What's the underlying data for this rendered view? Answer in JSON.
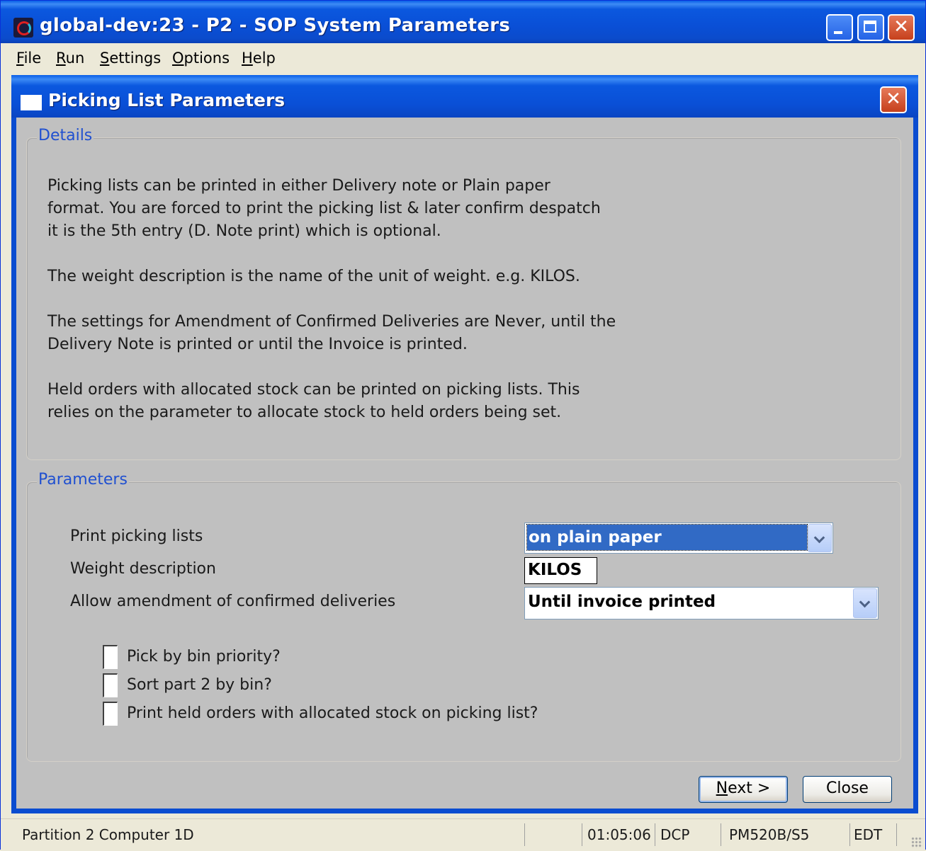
{
  "window": {
    "title": "global-dev:23 - P2 - SOP System Parameters"
  },
  "menu": {
    "items": [
      {
        "accel": "F",
        "rest": "ile"
      },
      {
        "accel": "R",
        "rest": "un"
      },
      {
        "accel": "S",
        "rest": "ettings"
      },
      {
        "accel": "O",
        "rest": "ptions"
      },
      {
        "accel": "H",
        "rest": "elp"
      }
    ]
  },
  "dialog": {
    "title": "Picking List Parameters",
    "details": {
      "legend": "Details",
      "para1": [
        "Picking lists can be printed in either Delivery note or Plain paper",
        "format. You are forced to print the picking list & later confirm despatch",
        "it is the 5th entry (D. Note print) which is optional."
      ],
      "para2": [
        "The weight description is the name of the unit of weight. e.g. KILOS."
      ],
      "para3": [
        "The settings for Amendment of Confirmed Deliveries are Never, until the",
        "Delivery Note is printed or until the Invoice is printed."
      ],
      "para4": [
        "Held orders with allocated stock can be printed on picking lists. This",
        "relies on the parameter to allocate stock to held orders being set."
      ]
    },
    "parameters": {
      "legend": "Parameters",
      "print_picking_lists": {
        "label": "Print picking lists",
        "value": "on plain paper"
      },
      "weight_description": {
        "label": "Weight description",
        "value": "KILOS"
      },
      "allow_amendment": {
        "label": "Allow amendment of confirmed deliveries",
        "value": "Until invoice printed"
      },
      "checkboxes": [
        {
          "label": "Pick by bin priority?",
          "checked": false
        },
        {
          "label": "Sort part 2 by bin?",
          "checked": false
        },
        {
          "label": "Print held orders with allocated stock on picking list?",
          "checked": false
        }
      ]
    },
    "buttons": {
      "next_accel": "N",
      "next_rest": "ext >",
      "close": "Close"
    }
  },
  "status": {
    "partition": "Partition 2 Computer 1D",
    "time": "01:05:06",
    "user": "DCP",
    "program": "PM520B/S5",
    "mode": "EDT"
  }
}
